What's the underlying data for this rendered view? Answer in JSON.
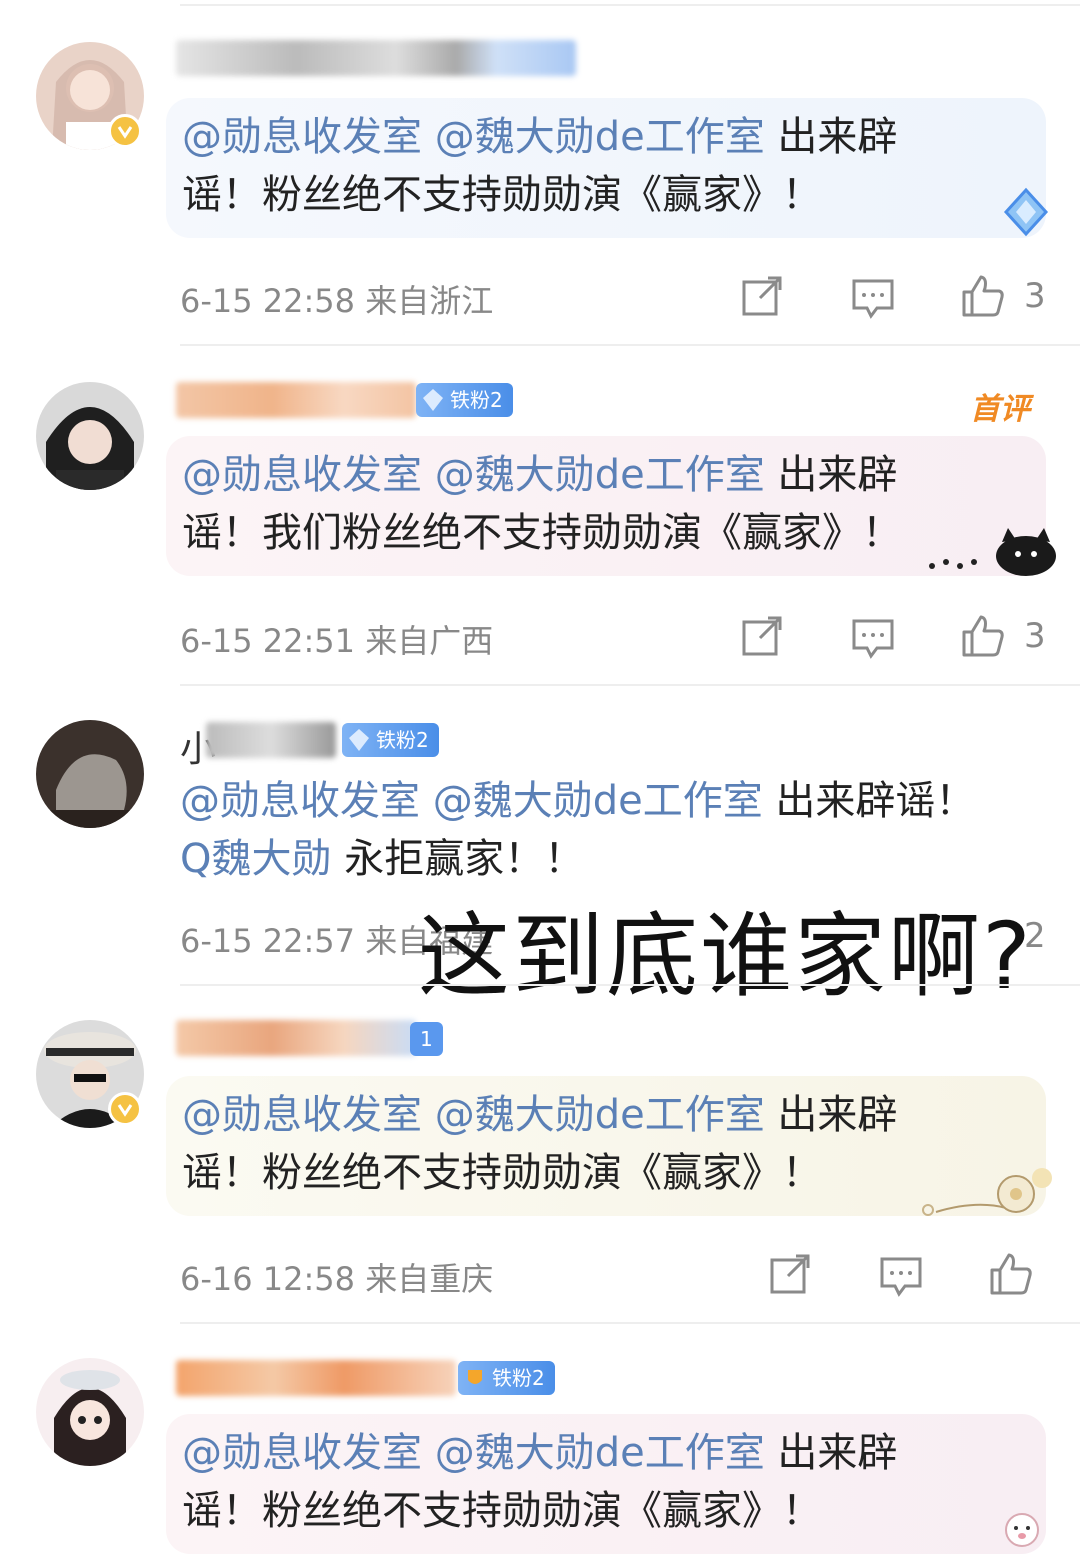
{
  "colors": {
    "mention": "#5b80b6",
    "meta": "#888888",
    "fan_badge": "#4a8ee8",
    "first_comment_tag": "#f08a24",
    "verified_badge": "#f5c243"
  },
  "comments": [
    {
      "name_visible": "",
      "fan_badge": "",
      "verified": true,
      "lines": [
        [
          {
            "t": "@勋息收发室",
            "m": true
          },
          {
            "t": " ",
            "m": false
          },
          {
            "t": "@魏大勋de工作室",
            "m": true
          },
          {
            "t": " 出来辟",
            "m": false
          }
        ],
        [
          {
            "t": "谣！粉丝绝不支持勋勋演《赢家》！",
            "m": false
          }
        ]
      ],
      "time": "6-15 22:58",
      "location": "来自浙江",
      "likes": "3"
    },
    {
      "name_visible": "",
      "fan_badge": "铁粉2",
      "first_tag": "首评",
      "verified": false,
      "lines": [
        [
          {
            "t": "@勋息收发室",
            "m": true
          },
          {
            "t": " ",
            "m": false
          },
          {
            "t": "@魏大勋de工作室",
            "m": true
          },
          {
            "t": " 出来辟",
            "m": false
          }
        ],
        [
          {
            "t": "谣！我们粉丝绝不支持勋勋演《赢家》！",
            "m": false
          }
        ]
      ],
      "time": "6-15 22:51",
      "location": "来自广西",
      "likes": "3"
    },
    {
      "name_visible": "小",
      "fan_badge": "铁粉2",
      "verified": false,
      "lines": [
        [
          {
            "t": "@勋息收发室",
            "m": true
          },
          {
            "t": " ",
            "m": false
          },
          {
            "t": "@魏大勋de工作室",
            "m": true
          },
          {
            "t": " 出来辟谣！",
            "m": false
          }
        ],
        [
          {
            "t": "Q魏大勋",
            "m": true
          },
          {
            "t": " 永拒赢家！！",
            "m": false
          }
        ]
      ],
      "time": "6-15 22:57",
      "location": "来自福建",
      "likes": "2"
    },
    {
      "name_visible": "",
      "fan_badge": "1",
      "verified": true,
      "lines": [
        [
          {
            "t": "@勋息收发室",
            "m": true
          },
          {
            "t": " ",
            "m": false
          },
          {
            "t": "@魏大勋de工作室",
            "m": true
          },
          {
            "t": " 出来辟",
            "m": false
          }
        ],
        [
          {
            "t": "谣！粉丝绝不支持勋勋演《赢家》！",
            "m": false
          }
        ]
      ],
      "time": "6-16 12:58",
      "location": "来自重庆",
      "likes": ""
    },
    {
      "name_visible": "",
      "fan_badge": "铁粉2",
      "verified": false,
      "lines": [
        [
          {
            "t": "@勋息收发室",
            "m": true
          },
          {
            "t": " ",
            "m": false
          },
          {
            "t": "@魏大勋de工作室",
            "m": true
          },
          {
            "t": " 出来辟",
            "m": false
          }
        ],
        [
          {
            "t": "谣！粉丝绝不支持勋勋演《赢家》！",
            "m": false
          }
        ]
      ],
      "time": "",
      "location": "",
      "likes": ""
    }
  ],
  "overlay_caption": "这到底谁家啊?",
  "icons": {
    "share": "share-icon",
    "comment": "comment-icon",
    "like": "thumbs-up-icon",
    "verified": "verified-v-icon",
    "search": "search-icon"
  }
}
